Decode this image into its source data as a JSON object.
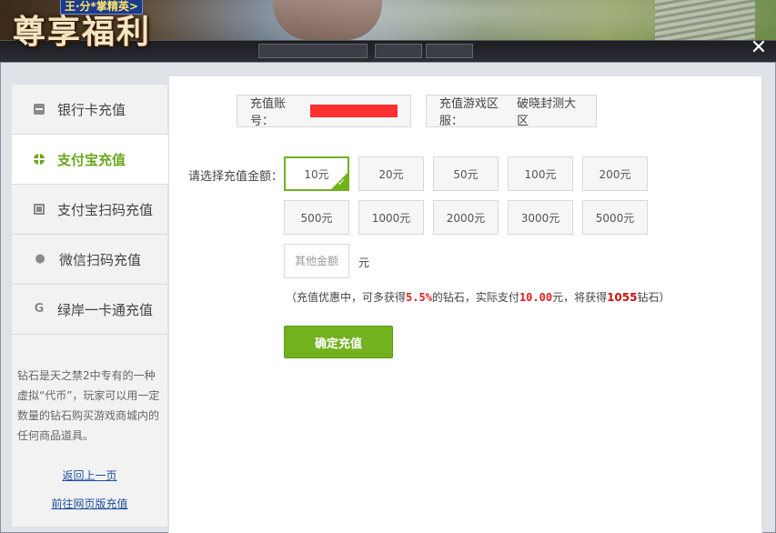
{
  "banner": {
    "title": "尊享福利",
    "tag": "王·分*掌精英>",
    "close_label": "✕"
  },
  "sidebar": {
    "items": [
      {
        "label": "银行卡充值",
        "icon": "bank-card-icon",
        "active": false
      },
      {
        "label": "支付宝充值",
        "icon": "alipay-icon",
        "active": true
      },
      {
        "label": "支付宝扫码充值",
        "icon": "qr-scan-icon",
        "active": false
      },
      {
        "label": "微信扫码充值",
        "icon": "wechat-icon",
        "active": false
      },
      {
        "label": "绿岸一卡通充值",
        "icon": "g-card-icon",
        "active": false
      }
    ],
    "description": "钻石是天之禁2中专有的一种虚拟“代币”，玩家可以用一定数量的钻石购买游戏商城内的任何商品道具。",
    "back_link": "返回上一页",
    "web_link": "前往网页版充值"
  },
  "main": {
    "account_label": "充值账号：",
    "account_value": "",
    "server_label": "充值游戏区服：",
    "server_value": "破晓封测大区",
    "amount_label": "请选择充值金额：",
    "amounts": [
      "10元",
      "20元",
      "50元",
      "100元",
      "200元",
      "500元",
      "1000元",
      "2000元",
      "3000元",
      "5000元"
    ],
    "selected_amount": "10元",
    "other_placeholder": "其他金额",
    "other_unit": "元",
    "promo": {
      "prefix": "（充值优惠中，可多获得",
      "percent": "5.5%",
      "mid1": "的钻石，实际支付",
      "pay": "10.00",
      "mid2": "元，将获得",
      "diamonds": "1055",
      "suffix": "钻石）"
    },
    "confirm_label": "确定充值"
  },
  "colors": {
    "accent": "#72b21e",
    "promo_red": "#e02020",
    "account_mask": "#ff3030"
  }
}
